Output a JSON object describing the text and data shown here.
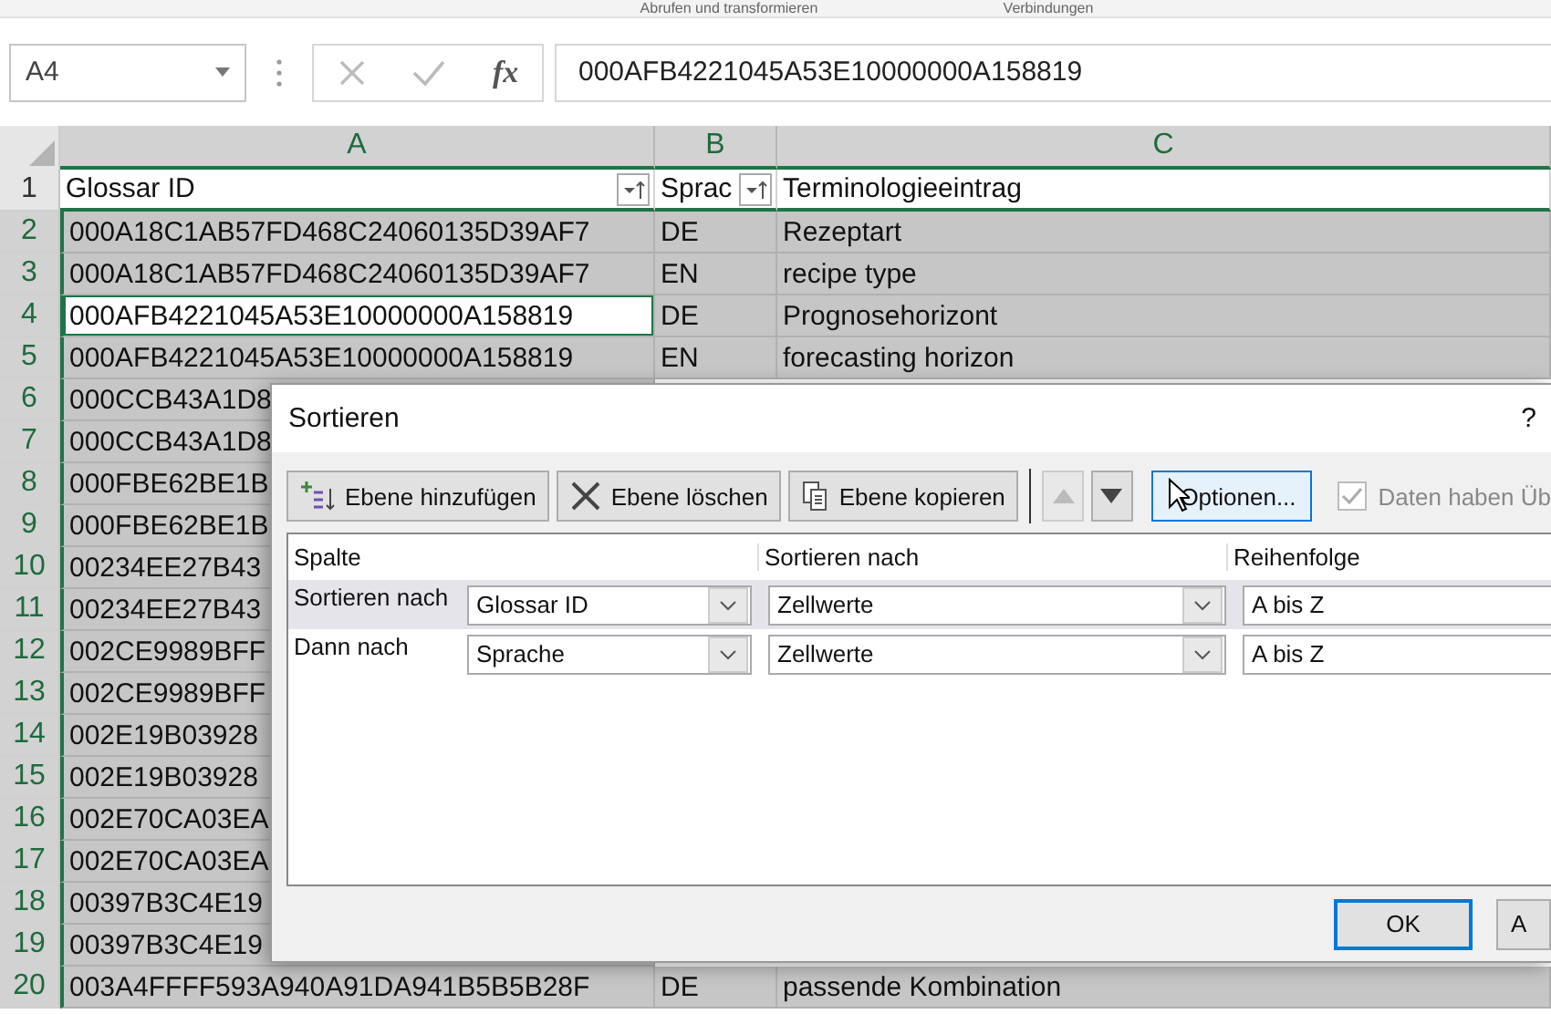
{
  "ribbon_groups": [
    "Abrufen und transformieren",
    "Verbindungen"
  ],
  "name_box": "A4",
  "formula_bar": {
    "function_button": "fx",
    "value": "000AFB4221045A53E10000000A158819"
  },
  "columns": [
    "A",
    "B",
    "C"
  ],
  "rows": [
    {
      "number": "1",
      "selected": false,
      "cells": [
        {
          "text": "Glossar ID",
          "filter": true,
          "active": false
        },
        {
          "text": "Sprac",
          "filter": true,
          "active": false
        },
        {
          "text": "Terminologieeintrag",
          "filter": false,
          "active": false
        }
      ]
    },
    {
      "number": "2",
      "selected": true,
      "cells": [
        {
          "text": "000A18C1AB57FD468C24060135D39AF7",
          "filter": false,
          "active": false
        },
        {
          "text": "DE",
          "filter": false,
          "active": false
        },
        {
          "text": "Rezeptart",
          "filter": false,
          "active": false
        }
      ]
    },
    {
      "number": "3",
      "selected": true,
      "cells": [
        {
          "text": "000A18C1AB57FD468C24060135D39AF7",
          "filter": false,
          "active": false
        },
        {
          "text": "EN",
          "filter": false,
          "active": false
        },
        {
          "text": "recipe type",
          "filter": false,
          "active": false
        }
      ]
    },
    {
      "number": "4",
      "selected": true,
      "cells": [
        {
          "text": "000AFB4221045A53E10000000A158819",
          "filter": false,
          "active": true
        },
        {
          "text": "DE",
          "filter": false,
          "active": false
        },
        {
          "text": "Prognosehorizont",
          "filter": false,
          "active": false
        }
      ]
    },
    {
      "number": "5",
      "selected": true,
      "cells": [
        {
          "text": "000AFB4221045A53E10000000A158819",
          "filter": false,
          "active": false
        },
        {
          "text": "EN",
          "filter": false,
          "active": false
        },
        {
          "text": "forecasting horizon",
          "filter": false,
          "active": false
        }
      ]
    },
    {
      "number": "6",
      "selected": true,
      "cells": [
        {
          "text": "000CCB43A1D8",
          "filter": false,
          "active": false
        }
      ]
    },
    {
      "number": "7",
      "selected": true,
      "cells": [
        {
          "text": "000CCB43A1D8",
          "filter": false,
          "active": false
        }
      ]
    },
    {
      "number": "8",
      "selected": true,
      "cells": [
        {
          "text": "000FBE62BE1B",
          "filter": false,
          "active": false
        }
      ]
    },
    {
      "number": "9",
      "selected": true,
      "cells": [
        {
          "text": "000FBE62BE1B",
          "filter": false,
          "active": false
        }
      ]
    },
    {
      "number": "10",
      "selected": true,
      "cells": [
        {
          "text": "00234EE27B43",
          "filter": false,
          "active": false
        }
      ]
    },
    {
      "number": "11",
      "selected": true,
      "cells": [
        {
          "text": "00234EE27B43",
          "filter": false,
          "active": false
        }
      ]
    },
    {
      "number": "12",
      "selected": true,
      "cells": [
        {
          "text": "002CE9989BFF",
          "filter": false,
          "active": false
        }
      ]
    },
    {
      "number": "13",
      "selected": true,
      "cells": [
        {
          "text": "002CE9989BFF",
          "filter": false,
          "active": false
        }
      ]
    },
    {
      "number": "14",
      "selected": true,
      "cells": [
        {
          "text": "002E19B03928",
          "filter": false,
          "active": false
        }
      ]
    },
    {
      "number": "15",
      "selected": true,
      "cells": [
        {
          "text": "002E19B03928",
          "filter": false,
          "active": false
        }
      ]
    },
    {
      "number": "16",
      "selected": true,
      "cells": [
        {
          "text": "002E70CA03EA",
          "filter": false,
          "active": false
        }
      ]
    },
    {
      "number": "17",
      "selected": true,
      "cells": [
        {
          "text": "002E70CA03EA",
          "filter": false,
          "active": false
        }
      ]
    },
    {
      "number": "18",
      "selected": true,
      "cells": [
        {
          "text": "00397B3C4E19",
          "filter": false,
          "active": false
        }
      ]
    },
    {
      "number": "19",
      "selected": true,
      "cells": [
        {
          "text": "00397B3C4E19",
          "filter": false,
          "active": false
        }
      ]
    },
    {
      "number": "20",
      "selected": true,
      "cells": [
        {
          "text": "003A4FFFF593A940A91DA941B5B5B28F",
          "filter": false,
          "active": false
        },
        {
          "text": "DE",
          "filter": false,
          "active": false
        },
        {
          "text": "passende Kombination",
          "filter": false,
          "active": false
        }
      ]
    }
  ],
  "dialog": {
    "title": "Sortieren",
    "help": "?",
    "toolbar": [
      {
        "kind": "add",
        "label": "Ebene hinzufügen"
      },
      {
        "kind": "delete",
        "label": "Ebene löschen"
      },
      {
        "kind": "copy",
        "label": "Ebene kopieren"
      }
    ],
    "move_up": {
      "disabled": true
    },
    "move_down": {
      "disabled": false
    },
    "options_button": "Optionen...",
    "header_checkbox": {
      "label": "Daten haben Üb",
      "checked": true,
      "disabled": true
    },
    "table_columns": [
      "Spalte",
      "Sortieren nach",
      "Reihenfolge"
    ],
    "levels": [
      {
        "label": "Sortieren nach",
        "column": "Glossar ID",
        "sort_on": "Zellwerte",
        "order": "A bis Z",
        "selected": true
      },
      {
        "label": "Dann nach",
        "column": "Sprache",
        "sort_on": "Zellwerte",
        "order": "A bis Z",
        "selected": false
      }
    ],
    "buttons": [
      "OK",
      "A"
    ]
  }
}
